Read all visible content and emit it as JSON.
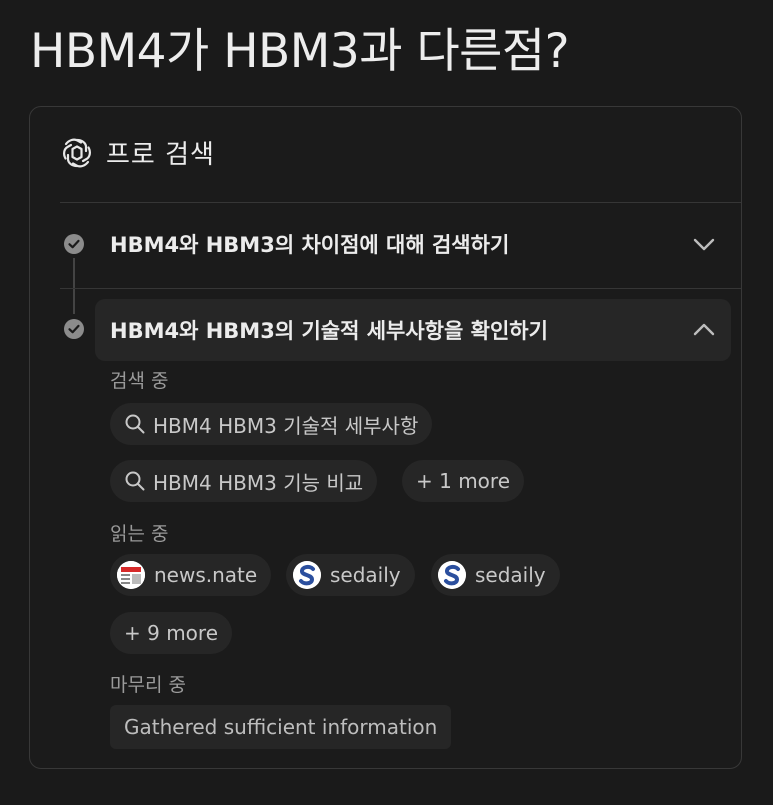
{
  "page": {
    "title": "HBM4가 HBM3과 다른점?"
  },
  "card": {
    "header_label": "프로 검색",
    "steps": [
      {
        "text": "HBM4와 HBM3의 차이점에 대해 검색하기",
        "expanded": false
      },
      {
        "text": "HBM4와 HBM3의 기술적 세부사항을 확인하기",
        "expanded": true
      }
    ],
    "searching": {
      "label": "검색 중",
      "queries": [
        "HBM4 HBM3 기술적 세부사항",
        "HBM4 HBM3 기능 비교"
      ],
      "more": "+ 1 more"
    },
    "reading": {
      "label": "읽는 중",
      "sources": [
        {
          "name": "news.nate",
          "icon": "news-favicon"
        },
        {
          "name": "sedaily",
          "icon": "sedaily-favicon"
        },
        {
          "name": "sedaily",
          "icon": "sedaily-favicon"
        }
      ],
      "more": "+ 9 more"
    },
    "finishing": {
      "label": "마무리 중",
      "status": "Gathered sufficient information"
    }
  },
  "colors": {
    "background": "#1a1a1a",
    "chip": "#262626",
    "border": "#383838",
    "check": "#8c8c8c"
  }
}
